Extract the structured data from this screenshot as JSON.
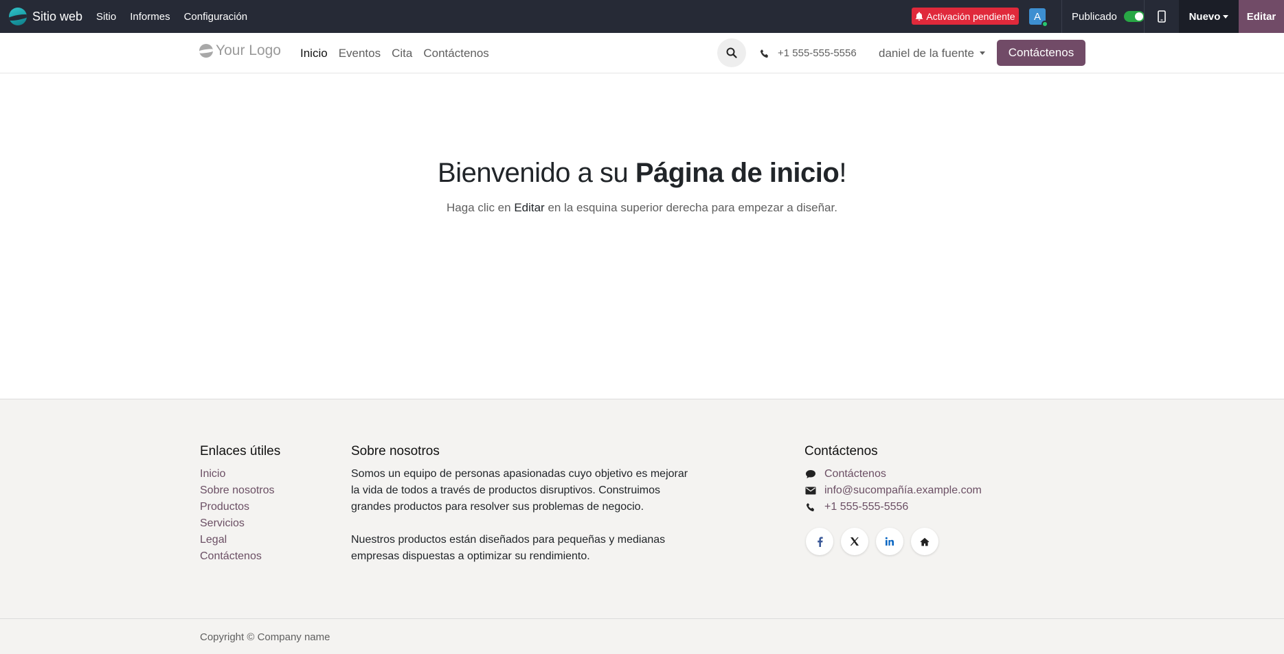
{
  "admin_bar": {
    "app_name": "Sitio web",
    "menu": [
      "Sitio",
      "Informes",
      "Configuración"
    ],
    "pending_label": "Activación pendiente",
    "avatar_letter": "A",
    "published_label": "Publicado",
    "published": true,
    "new_label": "Nuevo",
    "edit_label": "Editar",
    "colors": {
      "bar": "#262a36",
      "pending": "#e0293b",
      "edit": "#714b67",
      "toggle_on": "#28a745"
    }
  },
  "site_header": {
    "logo_text": "Your Logo",
    "nav": [
      "Inicio",
      "Eventos",
      "Cita",
      "Contáctenos"
    ],
    "active_nav": "Inicio",
    "phone": "+1 555-555-5556",
    "user": "daniel de la fuente",
    "cta_label": "Contáctenos"
  },
  "hero": {
    "title_plain": "Bienvenido a su ",
    "title_bold": "Página de inicio",
    "title_end": "!",
    "subtitle_before": "Haga clic en ",
    "subtitle_em": "Editar",
    "subtitle_after": " en la esquina superior derecha para empezar a diseñar."
  },
  "footer": {
    "links_title": "Enlaces útiles",
    "links": [
      "Inicio",
      "Sobre nosotros",
      "Productos",
      "Servicios",
      "Legal",
      "Contáctenos"
    ],
    "about_title": "Sobre nosotros",
    "about_p1": "Somos un equipo de personas apasionadas cuyo objetivo es mejorar la vida de todos a través de productos disruptivos. Construimos grandes productos para resolver sus problemas de negocio.",
    "about_p2": "Nuestros productos están diseñados para pequeñas y medianas empresas dispuestas a optimizar su rendimiento.",
    "contact_title": "Contáctenos",
    "contact_items": [
      {
        "icon": "comment-icon",
        "text": "Contáctenos"
      },
      {
        "icon": "envelope-icon",
        "text": "info@sucompañía.example.com"
      },
      {
        "icon": "phone-icon",
        "text": "+1 555-555-5556"
      }
    ],
    "socials": [
      "facebook-icon",
      "x-icon",
      "linkedin-icon",
      "home-icon"
    ],
    "copyright": "Copyright © Company name"
  }
}
